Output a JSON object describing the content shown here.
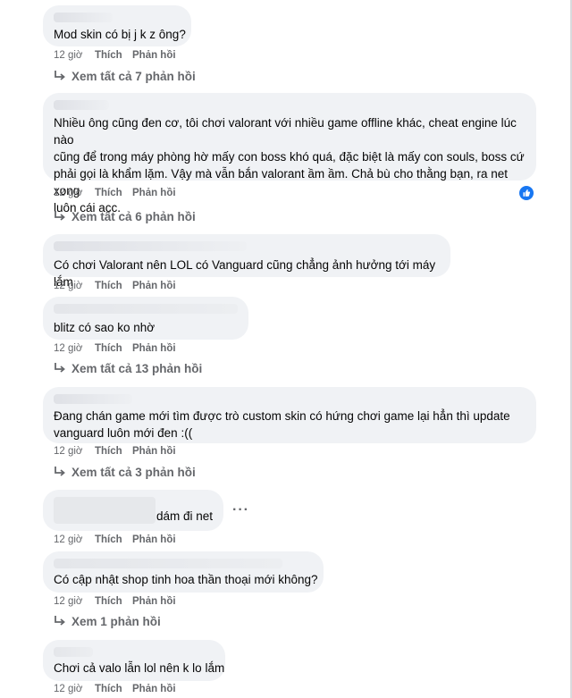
{
  "comments": [
    {
      "text": "Mod skin có bị j k z ông?",
      "time": "12 giờ",
      "like": "Thích",
      "reply": "Phản hồi",
      "view_replies": "Xem tất cả 7 phản hồi"
    },
    {
      "text": "Nhiều ông cũng đen cơ, tôi chơi valorant với nhiều game offline khác, cheat engine lúc nào\ncũng để trong máy phòng hờ mấy con boss khó quá, đặc biệt là mấy con souls, boss cứ\nphải gọi là khẩm lặm. Vậy mà vẫn bắn valorant ầm ầm. Chả bù cho thằng bạn, ra net xong\nluôn cái acc.",
      "time": "12 giờ",
      "like": "Thích",
      "reply": "Phản hồi",
      "view_replies": "Xem tất cả 6 phản hồi"
    },
    {
      "text": "Có chơi Valorant nên LOL có Vanguard cũng chẳng ảnh hưởng tới máy lắm",
      "time": "12 giờ",
      "like": "Thích",
      "reply": "Phản hồi"
    },
    {
      "text": "blitz có sao ko nhờ",
      "time": "12 giờ",
      "like": "Thích",
      "reply": "Phản hồi",
      "view_replies": "Xem tất cả 13 phản hồi"
    },
    {
      "text": "Đang chán game mới tìm được trò custom skin có hứng chơi game lại hẳn thì update\nvanguard luôn mới đen :((",
      "time": "12 giờ",
      "like": "Thích",
      "reply": "Phản hồi",
      "view_replies": "Xem tất cả 3 phản hồi"
    },
    {
      "text": "dám đi net",
      "time": "12 giờ",
      "like": "Thích",
      "reply": "Phản hồi",
      "more": "···"
    },
    {
      "text": "Có cập nhật shop tinh hoa thần thoại mới không?",
      "time": "12 giờ",
      "like": "Thích",
      "reply": "Phản hồi",
      "view_replies": "Xem 1 phản hồi"
    },
    {
      "text": "Chơi cả valo lẫn lol nên k lo lắm",
      "time": "12 giờ",
      "like": "Thích",
      "reply": "Phản hồi"
    }
  ],
  "icons": {
    "reply_arrow": "reply-arrow-icon",
    "like_reaction": "like-reaction-icon",
    "more": "more-options-icon"
  },
  "colors": {
    "bubble": "#f0f2f5",
    "text": "#050505",
    "secondary": "#65676b",
    "accent": "#1877f2"
  }
}
